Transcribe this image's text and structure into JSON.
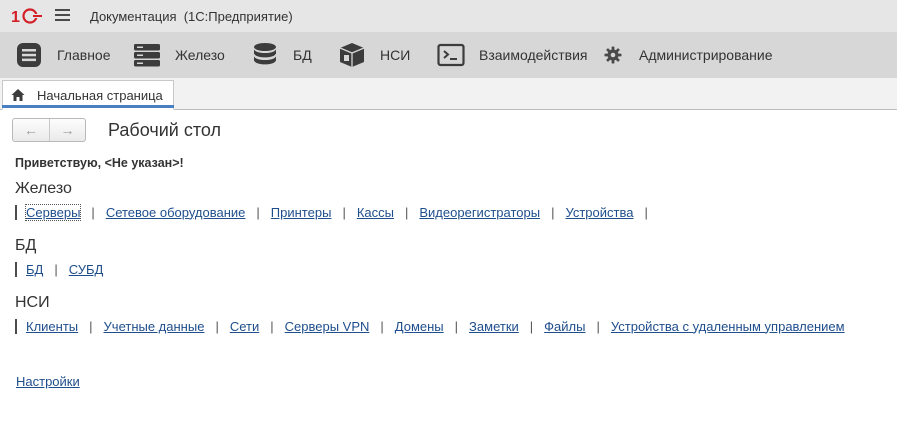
{
  "titlebar": {
    "logo": "1С",
    "title": "Документация  (1С:Предприятие)"
  },
  "sections": [
    {
      "label": "Главное",
      "icon": "main-menu-icon"
    },
    {
      "label": "Железо",
      "icon": "server-rack-icon"
    },
    {
      "label": "БД",
      "icon": "database-icon"
    },
    {
      "label": "НСИ",
      "icon": "reference-box-icon"
    },
    {
      "label": "Взаимодействия",
      "icon": "terminal-icon"
    },
    {
      "label": "Администрирование",
      "icon": "gear-icon"
    }
  ],
  "tabs": [
    {
      "label": "Начальная страница",
      "icon": "home-icon"
    }
  ],
  "toolbar": {
    "back": "←",
    "forward": "→"
  },
  "page": {
    "title": "Рабочий стол",
    "greeting": "Приветствую, <Не указан>!"
  },
  "groups": [
    {
      "title": "Железо",
      "links": [
        "Серверы",
        "Сетевое оборудование",
        "Принтеры",
        "Кассы",
        "Видеорегистраторы",
        "Устройства"
      ]
    },
    {
      "title": "БД",
      "links": [
        "БД",
        "СУБД"
      ]
    },
    {
      "title": "НСИ",
      "links": [
        "Клиенты",
        "Учетные данные",
        "Сети",
        "Серверы VPN",
        "Домены",
        "Заметки",
        "Файлы",
        "Устройства с удаленным управлением"
      ]
    }
  ],
  "settings_link": "Настройки",
  "colors": {
    "accent": "#4a7fc1",
    "link": "#1f4e8c",
    "logo_red": "#d32027"
  }
}
